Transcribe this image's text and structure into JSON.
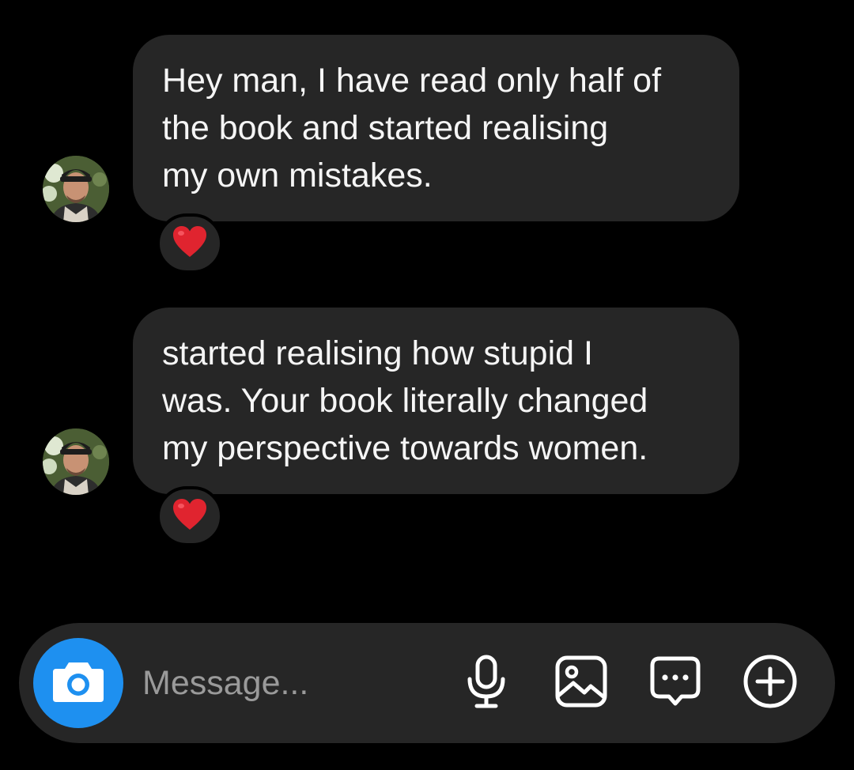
{
  "thread": {
    "messages": [
      {
        "text": "Hey man, I have read only half of\nthe book and started realising\nmy own mistakes.",
        "reaction": "❤️"
      },
      {
        "text": "started realising how stupid I\nwas. Your book literally changed\nmy perspective towards women.",
        "reaction": "❤️"
      }
    ]
  },
  "composer": {
    "placeholder": "Message...",
    "icons": [
      "camera-icon",
      "microphone-icon",
      "gallery-icon",
      "sticker-chat-icon",
      "add-icon"
    ]
  },
  "colors": {
    "background": "#000000",
    "bubble": "#262626",
    "accent": "#1e90f0",
    "placeholder": "#9a9a9a",
    "reaction_heart": "#e0242f"
  }
}
